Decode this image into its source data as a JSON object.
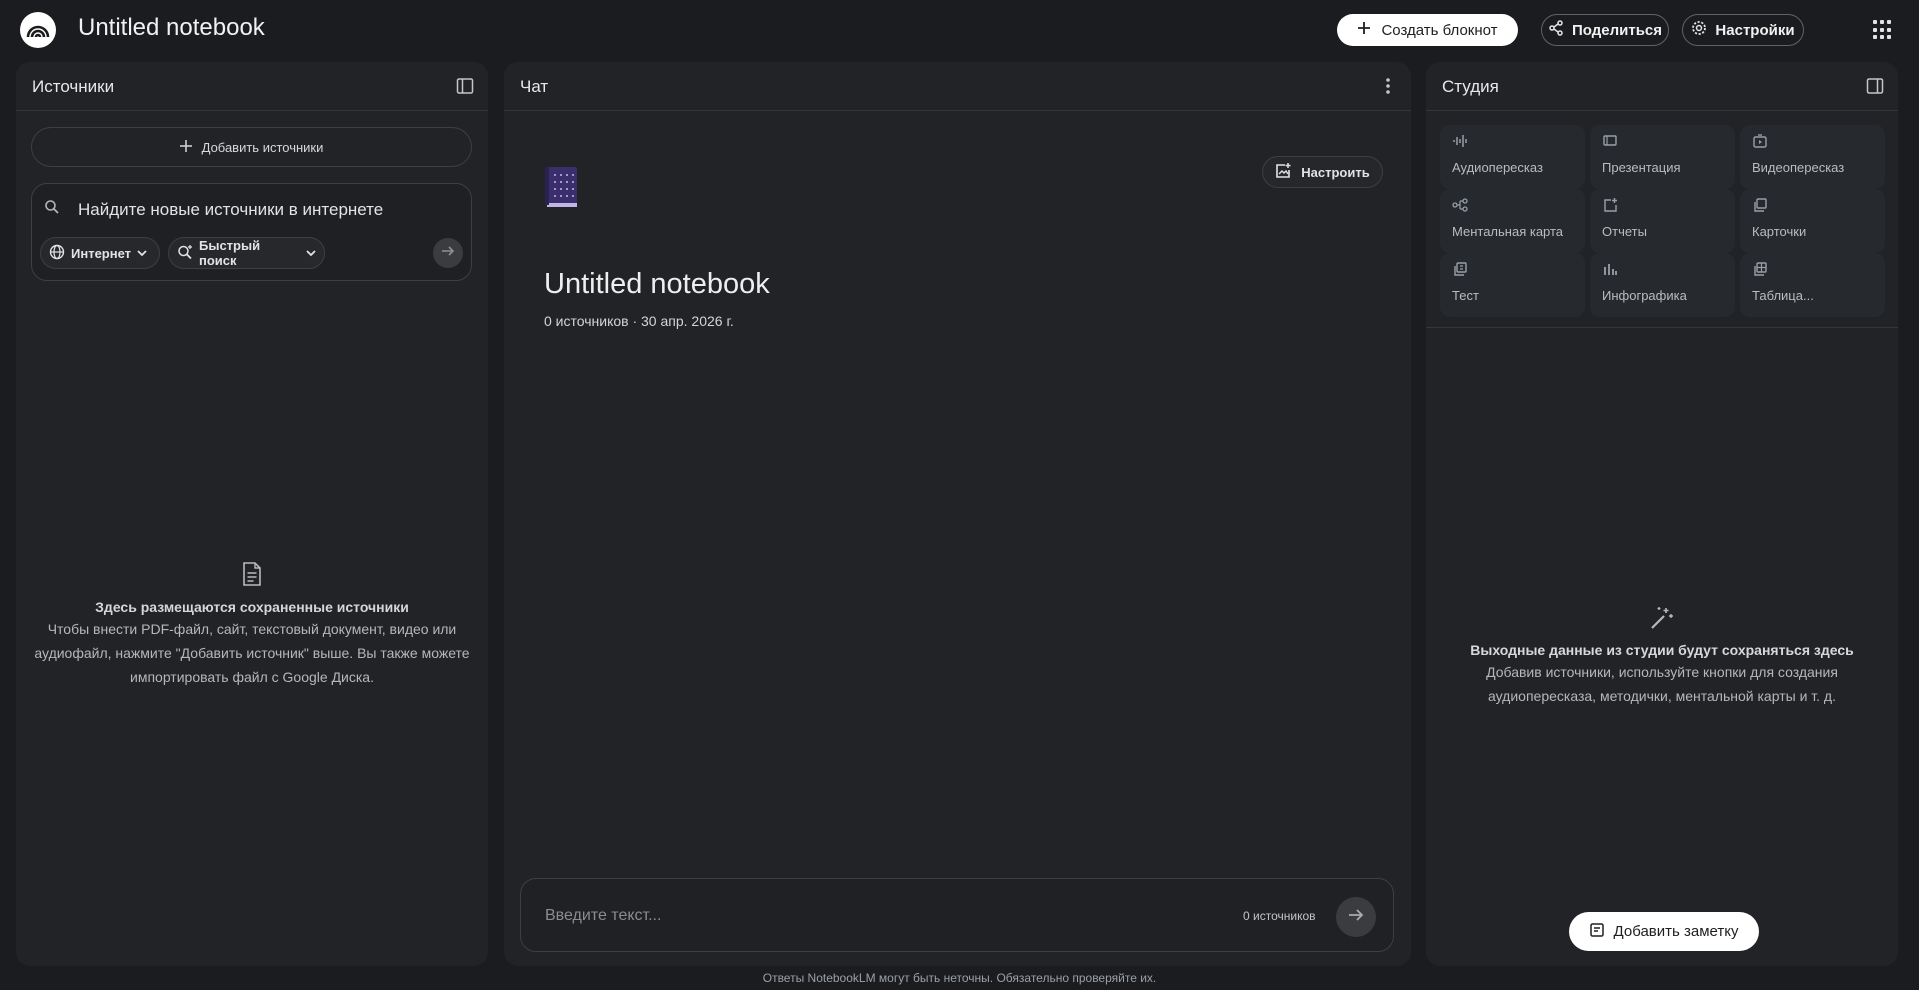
{
  "header": {
    "app_title": "Untitled notebook",
    "create_label": "Создать блокнот",
    "share_label": "Поделиться",
    "settings_label": "Настройки"
  },
  "sources": {
    "title": "Источники",
    "add_label": "Добавить источники",
    "search_text": "Найдите новые источники в интернете",
    "chip_web": "Интернет",
    "chip_fast": "Быстрый поиск",
    "empty_title": "Здесь размещаются сохраненные источники",
    "empty_desc": "Чтобы внести PDF-файл, сайт, текстовый документ, видео или аудиофайл, нажмите \"Добавить источник\" выше. Вы также можете импортировать файл с Google Диска."
  },
  "chat": {
    "title": "Чат",
    "customize_label": "Настроить",
    "notebook_title": "Untitled notebook",
    "notebook_meta": "0 источников · 30 апр. 2026 г.",
    "input_placeholder": "Введите текст...",
    "sources_count": "0 источников"
  },
  "studio": {
    "title": "Студия",
    "items": [
      {
        "label": "Аудиопересказ",
        "icon": "audio-wave-icon"
      },
      {
        "label": "Презентация",
        "icon": "slides-icon"
      },
      {
        "label": "Видеопересказ",
        "icon": "video-icon"
      },
      {
        "label": "Ментальная карта",
        "icon": "mindmap-icon"
      },
      {
        "label": "Отчеты",
        "icon": "report-icon"
      },
      {
        "label": "Карточки",
        "icon": "flashcards-icon"
      },
      {
        "label": "Тест",
        "icon": "quiz-icon"
      },
      {
        "label": "Инфографика",
        "icon": "infographic-icon"
      },
      {
        "label": "Таблица...",
        "icon": "table-icon"
      }
    ],
    "empty_title": "Выходные данные из студии будут сохраняться здесь",
    "empty_desc": "Добавив источники, используйте кнопки для создания аудиопересказа, методички, ментальной карты и т. д.",
    "add_note_label": "Добавить заметку"
  },
  "footer": {
    "disclaimer": "Ответы NotebookLM могут быть неточны. Обязательно проверяйте их."
  },
  "colors": {
    "background": "#1b1c1f",
    "panel": "#212327",
    "tile": "#262a2e",
    "button_light": "#ffffff"
  }
}
